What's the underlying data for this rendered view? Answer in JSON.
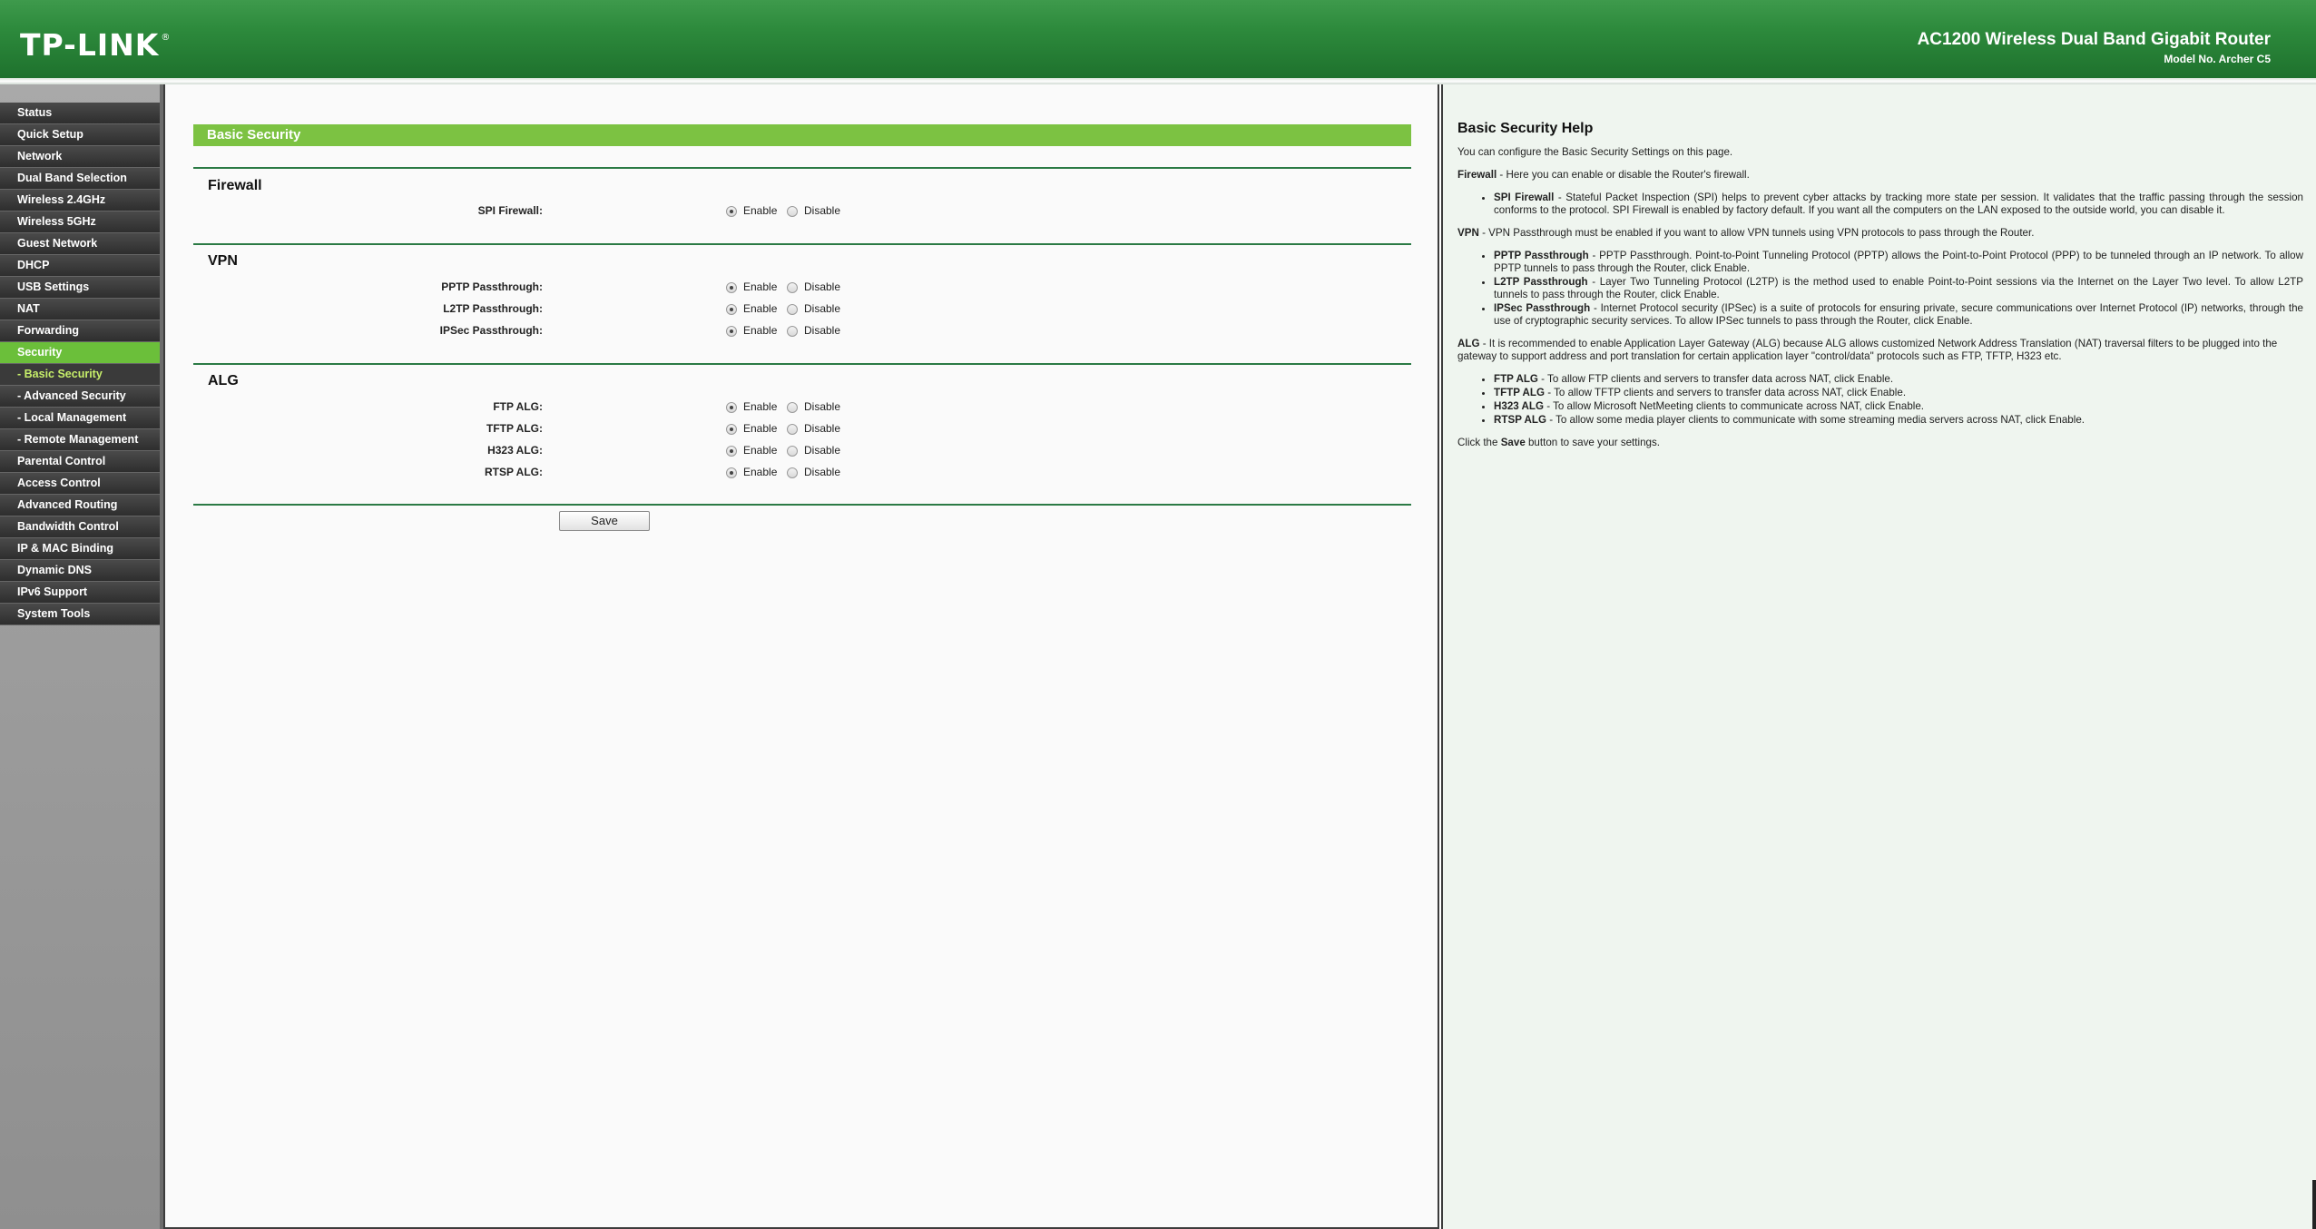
{
  "header": {
    "logo": "TP-LINK",
    "logo_reg": "®",
    "product_name": "AC1200 Wireless Dual Band Gigabit Router",
    "model_no": "Model No. Archer C5"
  },
  "sidebar": {
    "items": [
      {
        "label": "Status"
      },
      {
        "label": "Quick Setup"
      },
      {
        "label": "Network"
      },
      {
        "label": "Dual Band Selection"
      },
      {
        "label": "Wireless 2.4GHz"
      },
      {
        "label": "Wireless 5GHz"
      },
      {
        "label": "Guest Network"
      },
      {
        "label": "DHCP"
      },
      {
        "label": "USB Settings"
      },
      {
        "label": "NAT"
      },
      {
        "label": "Forwarding"
      },
      {
        "label": "Security"
      },
      {
        "label": "- Basic Security"
      },
      {
        "label": "- Advanced Security"
      },
      {
        "label": "- Local Management"
      },
      {
        "label": "- Remote Management"
      },
      {
        "label": "Parental Control"
      },
      {
        "label": "Access Control"
      },
      {
        "label": "Advanced Routing"
      },
      {
        "label": "Bandwidth Control"
      },
      {
        "label": "IP & MAC Binding"
      },
      {
        "label": "Dynamic DNS"
      },
      {
        "label": "IPv6 Support"
      },
      {
        "label": "System Tools"
      }
    ]
  },
  "main": {
    "title": "Basic Security",
    "enable_label": "Enable",
    "disable_label": "Disable",
    "save_label": "Save",
    "sections": {
      "firewall": {
        "title": "Firewall",
        "rows": [
          {
            "label": "SPI Firewall:",
            "value": "Enable"
          }
        ]
      },
      "vpn": {
        "title": "VPN",
        "rows": [
          {
            "label": "PPTP Passthrough:",
            "value": "Enable"
          },
          {
            "label": "L2TP Passthrough:",
            "value": "Enable"
          },
          {
            "label": "IPSec Passthrough:",
            "value": "Enable"
          }
        ]
      },
      "alg": {
        "title": "ALG",
        "rows": [
          {
            "label": "FTP ALG:",
            "value": "Enable"
          },
          {
            "label": "TFTP ALG:",
            "value": "Enable"
          },
          {
            "label": "H323 ALG:",
            "value": "Enable"
          },
          {
            "label": "RTSP ALG:",
            "value": "Enable"
          }
        ]
      }
    }
  },
  "help": {
    "title": "Basic Security Help",
    "intro": "You can configure the Basic Security Settings on this page.",
    "firewall_term": "Firewall",
    "firewall_text": " - Here you can enable or disable the Router's firewall.",
    "spi_term": "SPI Firewall",
    "spi_text": " - Stateful Packet Inspection (SPI) helps to prevent cyber attacks by tracking more state per session. It validates that the traffic passing through the session conforms to the protocol. SPI Firewall is enabled by factory default. If you want all the computers on the LAN exposed to the outside world, you can disable it.",
    "vpn_term": "VPN",
    "vpn_text": " - VPN Passthrough must be enabled if you want to allow VPN tunnels using VPN protocols to pass through the Router.",
    "pptp_term": "PPTP Passthrough",
    "pptp_text": " - PPTP Passthrough. Point-to-Point Tunneling Protocol (PPTP) allows the Point-to-Point Protocol (PPP) to be tunneled through an IP network. To allow PPTP tunnels to pass through the Router, click Enable.",
    "l2tp_term": "L2TP Passthrough",
    "l2tp_text": " - Layer Two Tunneling Protocol (L2TP) is the method used to enable Point-to-Point sessions via the Internet on the Layer Two level. To allow L2TP tunnels to pass through the Router, click Enable.",
    "ipsec_term": "IPSec Passthrough",
    "ipsec_text": " - Internet Protocol security (IPSec) is a suite of protocols for ensuring private, secure communications over Internet Protocol (IP) networks, through the use of cryptographic security services. To allow IPSec tunnels to pass through the Router, click Enable.",
    "alg_term": "ALG",
    "alg_text": " - It is recommended to enable Application Layer Gateway (ALG) because ALG allows customized Network Address Translation (NAT) traversal filters to be plugged into the gateway to support address and port translation for certain application layer \"control/data\" protocols such as FTP, TFTP, H323 etc.",
    "ftp_term": "FTP ALG",
    "ftp_text": " - To allow FTP clients and servers to transfer data across NAT, click Enable.",
    "tftp_term": "TFTP ALG",
    "tftp_text": " - To allow TFTP clients and servers to transfer data across NAT, click Enable.",
    "h323_term": "H323 ALG",
    "h323_text": " - To allow Microsoft NetMeeting clients to communicate across NAT, click Enable.",
    "rtsp_term": "RTSP ALG",
    "rtsp_text": " - To allow some media player clients to communicate with some streaming media servers across NAT, click Enable.",
    "outro_pre": "Click the ",
    "outro_term": "Save",
    "outro_post": " button to save your settings."
  },
  "colors": {
    "header_green": "#2d8a3c",
    "accent_green": "#7cc242",
    "active_menu": "#6bbf3a",
    "active_sub_text": "#c7ef6a",
    "rule_green": "#2b7a45",
    "help_bg": "#eff5ef"
  }
}
